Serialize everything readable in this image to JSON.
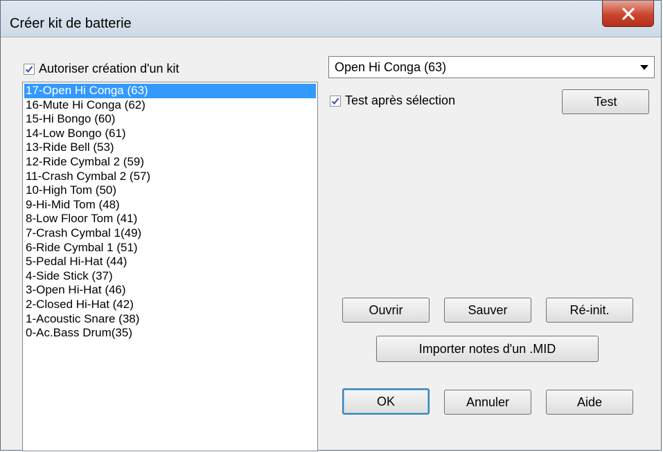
{
  "window": {
    "title": "Créer kit de batterie"
  },
  "allow_kit": {
    "label": "Autoriser création d'un kit",
    "checked": true
  },
  "instrument_list": {
    "selected_index": 0,
    "items": [
      "17-Open Hi Conga (63)",
      "16-Mute Hi Conga (62)",
      "15-Hi Bongo (60)",
      "14-Low Bongo (61)",
      "13-Ride Bell (53)",
      "12-Ride Cymbal 2 (59)",
      "11-Crash Cymbal 2 (57)",
      "10-High Tom (50)",
      "9-Hi-Mid Tom (48)",
      "8-Low Floor Tom (41)",
      "7-Crash Cymbal 1(49)",
      "6-Ride Cymbal 1 (51)",
      "5-Pedal Hi-Hat (44)",
      "4-Side Stick (37)",
      "3-Open Hi-Hat (46)",
      "2-Closed Hi-Hat (42)",
      "1-Acoustic Snare (38)",
      "0-Ac.Bass Drum(35)"
    ]
  },
  "sound_select": {
    "value": "Open Hi Conga (63)"
  },
  "test_after_select": {
    "label": "Test après sélection",
    "checked": true
  },
  "buttons": {
    "test": "Test",
    "open": "Ouvrir",
    "save": "Sauver",
    "reset": "Ré-init.",
    "import_mid": "Importer notes d'un .MID",
    "ok": "OK",
    "cancel": "Annuler",
    "help": "Aide"
  },
  "colors": {
    "selection": "#3399ff",
    "close_button": "#c9452d"
  }
}
